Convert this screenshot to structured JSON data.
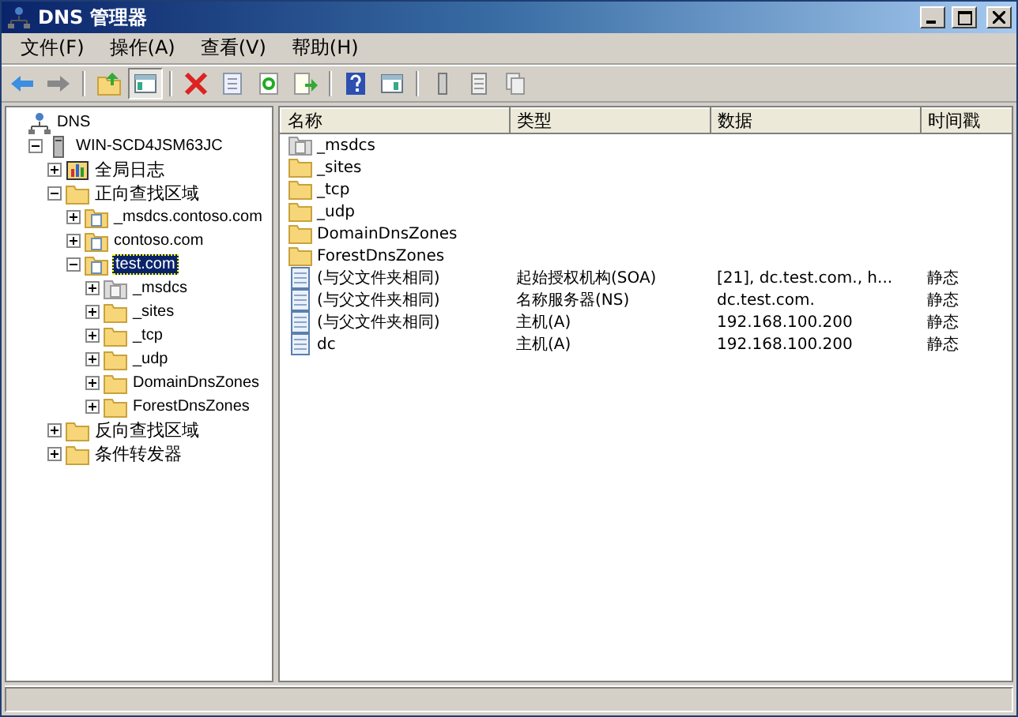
{
  "window": {
    "title": "DNS 管理器"
  },
  "menu": [
    "文件(F)",
    "操作(A)",
    "查看(V)",
    "帮助(H)"
  ],
  "toolbar": [
    {
      "kind": "back"
    },
    {
      "kind": "forward"
    },
    {
      "kind": "sep"
    },
    {
      "kind": "up"
    },
    {
      "kind": "tree",
      "selected": true
    },
    {
      "kind": "sep"
    },
    {
      "kind": "delete"
    },
    {
      "kind": "properties"
    },
    {
      "kind": "refresh"
    },
    {
      "kind": "export"
    },
    {
      "kind": "sep"
    },
    {
      "kind": "help"
    },
    {
      "kind": "console"
    },
    {
      "kind": "sep"
    },
    {
      "kind": "server"
    },
    {
      "kind": "list"
    },
    {
      "kind": "copy"
    }
  ],
  "tree": [
    {
      "label": "DNS",
      "kind": "dns",
      "selected": false,
      "children": [
        {
          "label": "WIN-SCD4JSM63JC",
          "kind": "server",
          "expanded": true,
          "selected": false,
          "children": [
            {
              "label": "全局日志",
              "kind": "log",
              "expanded": false,
              "selected": false
            },
            {
              "label": "正向查找区域",
              "kind": "folder",
              "expanded": true,
              "selected": false,
              "children": [
                {
                  "label": "_msdcs.contoso.com",
                  "kind": "zone",
                  "expanded": false,
                  "selected": false
                },
                {
                  "label": "contoso.com",
                  "kind": "zone",
                  "expanded": false,
                  "selected": false
                },
                {
                  "label": "test.com",
                  "kind": "zone",
                  "expanded": true,
                  "selected": true,
                  "children": [
                    {
                      "label": "_msdcs",
                      "kind": "grey",
                      "expanded": false,
                      "selected": false
                    },
                    {
                      "label": "_sites",
                      "kind": "folder",
                      "expanded": false,
                      "selected": false
                    },
                    {
                      "label": "_tcp",
                      "kind": "folder",
                      "expanded": false,
                      "selected": false
                    },
                    {
                      "label": "_udp",
                      "kind": "folder",
                      "expanded": false,
                      "selected": false
                    },
                    {
                      "label": "DomainDnsZones",
                      "kind": "folder",
                      "expanded": false,
                      "selected": false
                    },
                    {
                      "label": "ForestDnsZones",
                      "kind": "folder",
                      "expanded": false,
                      "selected": false
                    }
                  ]
                }
              ]
            },
            {
              "label": "反向查找区域",
              "kind": "folder",
              "expanded": false,
              "selected": false
            },
            {
              "label": "条件转发器",
              "kind": "folder",
              "expanded": false,
              "selected": false
            }
          ]
        }
      ]
    }
  ],
  "table": {
    "columns": [
      "名称",
      "类型",
      "数据",
      "时间戳"
    ],
    "rows": [
      {
        "kind": "grey",
        "cells": [
          "_msdcs",
          "",
          "",
          ""
        ]
      },
      {
        "kind": "folder",
        "cells": [
          "_sites",
          "",
          "",
          ""
        ]
      },
      {
        "kind": "folder",
        "cells": [
          "_tcp",
          "",
          "",
          ""
        ]
      },
      {
        "kind": "folder",
        "cells": [
          "_udp",
          "",
          "",
          ""
        ]
      },
      {
        "kind": "folder",
        "cells": [
          "DomainDnsZones",
          "",
          "",
          ""
        ]
      },
      {
        "kind": "folder",
        "cells": [
          "ForestDnsZones",
          "",
          "",
          ""
        ]
      },
      {
        "kind": "record",
        "cells": [
          "(与父文件夹相同)",
          "起始授权机构(SOA)",
          "[21], dc.test.com., h...",
          "静态"
        ]
      },
      {
        "kind": "record",
        "cells": [
          "(与父文件夹相同)",
          "名称服务器(NS)",
          "dc.test.com.",
          "静态"
        ]
      },
      {
        "kind": "record",
        "cells": [
          "(与父文件夹相同)",
          "主机(A)",
          "192.168.100.200",
          "静态"
        ]
      },
      {
        "kind": "record",
        "cells": [
          "dc",
          "主机(A)",
          "192.168.100.200",
          "静态"
        ]
      }
    ]
  }
}
